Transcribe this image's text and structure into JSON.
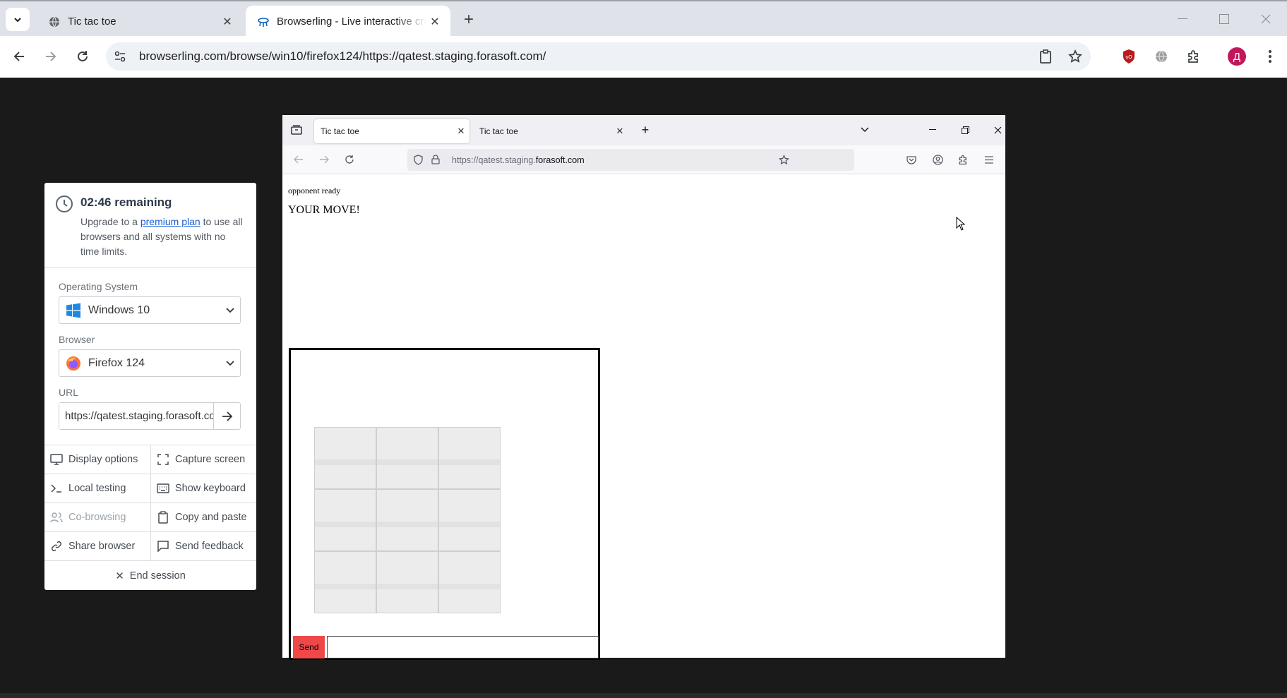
{
  "chrome": {
    "tabs": [
      {
        "title": "Tic tac toe"
      },
      {
        "title": "Browserling - Live interactive cross-browser testing"
      }
    ],
    "omnibox_url": "browserling.com/browse/win10/firefox124/https://qatest.staging.forasoft.com/",
    "profile_initial": "Д"
  },
  "panel": {
    "time_remaining": "02:46 remaining",
    "upgrade_prefix": "Upgrade to a",
    "upgrade_link": "premium plan",
    "upgrade_suffix": "to use all browsers and all systems with no time limits.",
    "os_label": "Operating System",
    "os_value": "Windows 10",
    "browser_label": "Browser",
    "browser_value": "Firefox 124",
    "url_label": "URL",
    "url_value": "https://qatest.staging.forasoft.com/",
    "actions": [
      {
        "label": "Display options",
        "icon": "monitor-icon"
      },
      {
        "label": "Capture screen",
        "icon": "capture-icon"
      },
      {
        "label": "Local testing",
        "icon": "terminal-icon"
      },
      {
        "label": "Show keyboard",
        "icon": "keyboard-icon"
      },
      {
        "label": "Co-browsing",
        "icon": "users-icon"
      },
      {
        "label": "Copy and paste",
        "icon": "clipboard-icon"
      },
      {
        "label": "Share browser",
        "icon": "link-icon"
      },
      {
        "label": "Send feedback",
        "icon": "message-icon"
      }
    ],
    "end_session": "End session"
  },
  "firefox": {
    "tabs": [
      {
        "title": "Tic tac toe"
      },
      {
        "title": "Tic tac toe"
      }
    ],
    "url_prefix": "https://qatest.staging.",
    "url_domain": "forasoft.com"
  },
  "game": {
    "status": "opponent ready",
    "move_prompt": "YOUR MOVE!",
    "send_label": "Send",
    "message_value": ""
  },
  "colors": {
    "send_button": "#f04848",
    "link": "#1a5fd0",
    "ublock_red": "#b71c1c",
    "avatar": "#c2185b"
  }
}
